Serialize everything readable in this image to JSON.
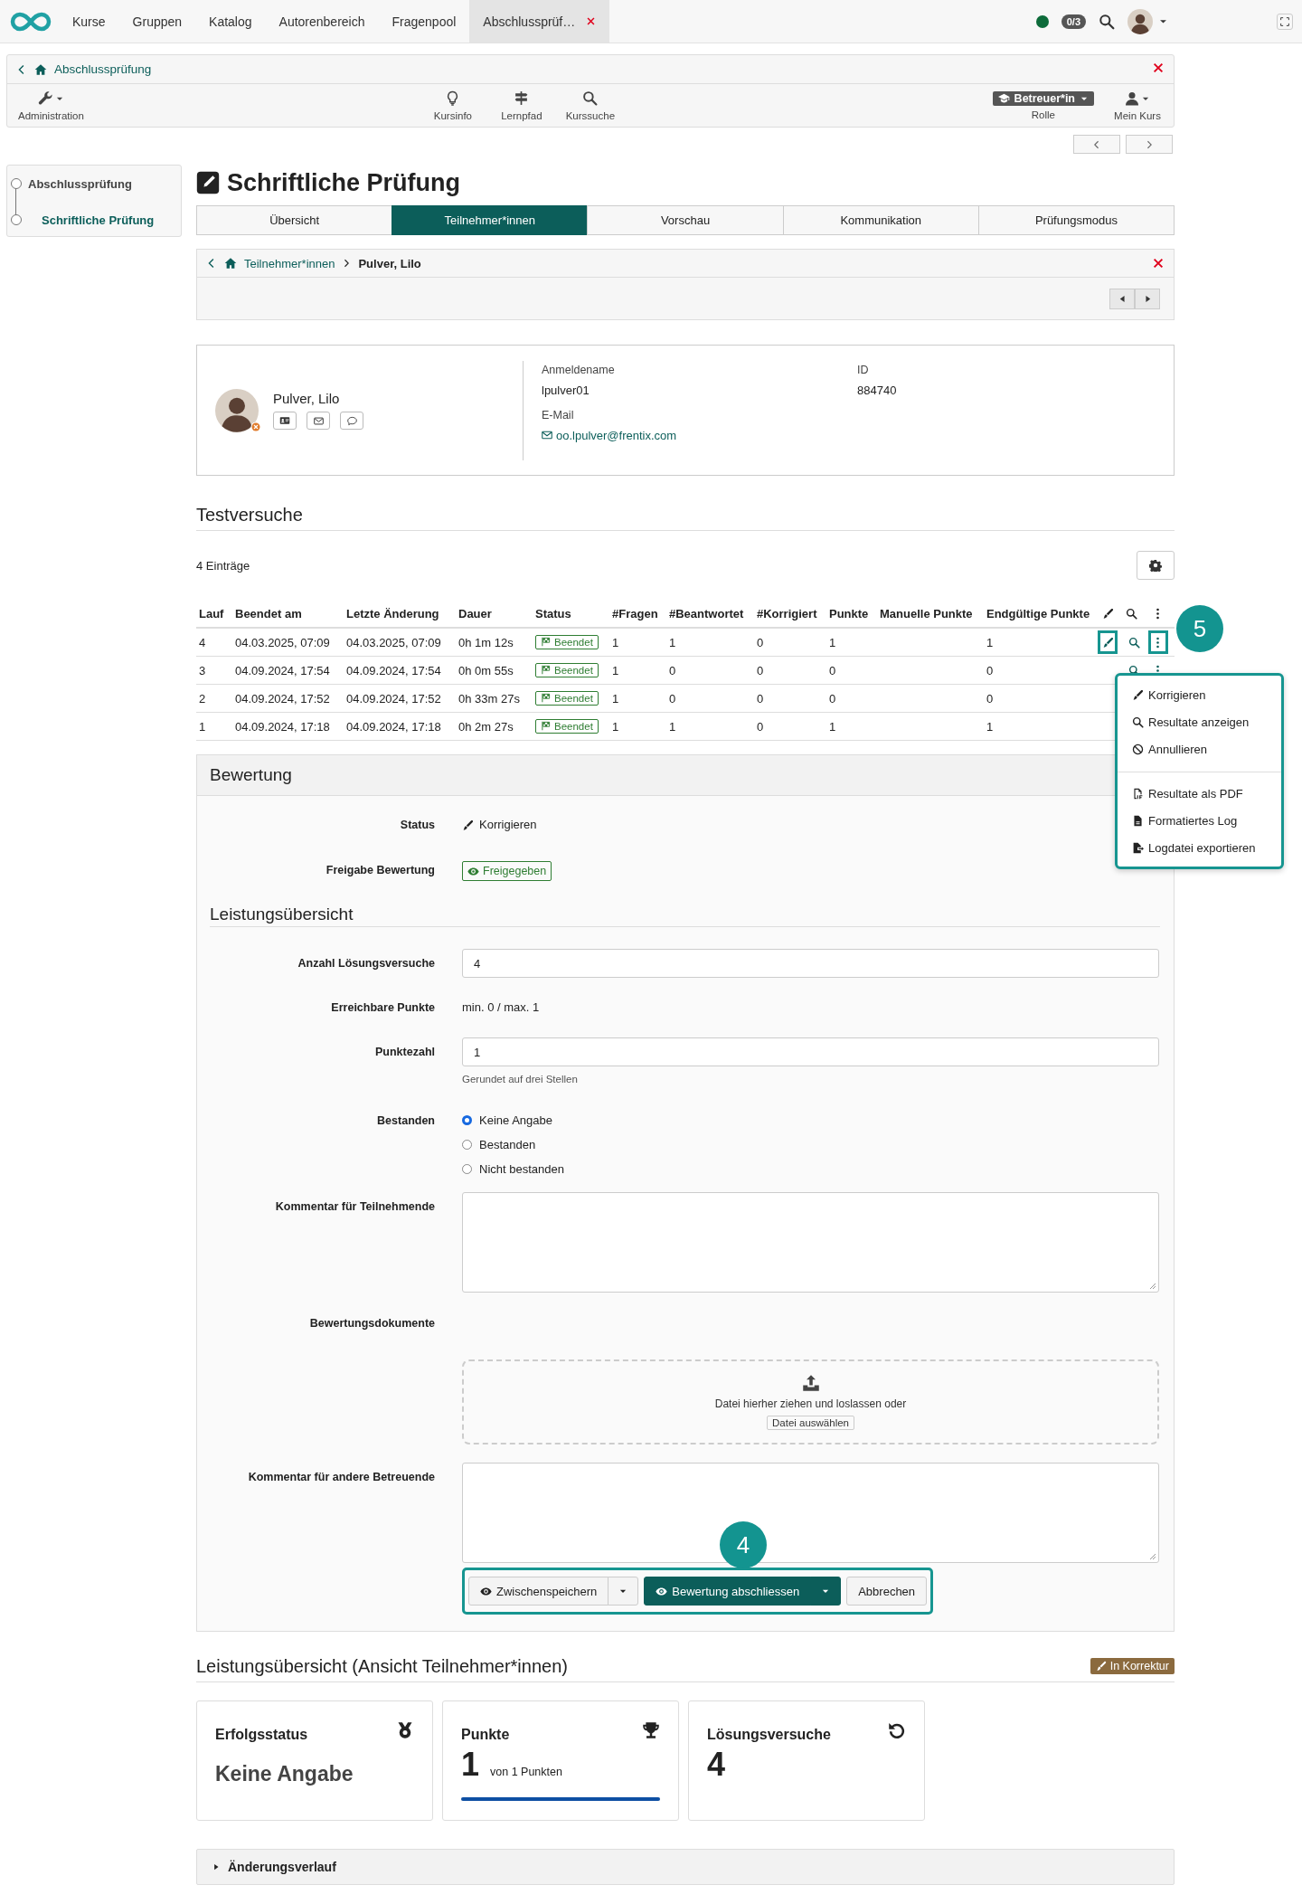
{
  "top_nav": {
    "tabs": [
      {
        "label": "Kurse",
        "selected": false,
        "closable": false
      },
      {
        "label": "Gruppen",
        "selected": false,
        "closable": false
      },
      {
        "label": "Katalog",
        "selected": false,
        "closable": false
      },
      {
        "label": "Autorenbereich",
        "selected": false,
        "closable": false
      },
      {
        "label": "Fragenpool",
        "selected": false,
        "closable": false
      },
      {
        "label": "Abschlussprüf…",
        "selected": true,
        "closable": true
      }
    ],
    "online": true,
    "counter": "0/3"
  },
  "course_bar": {
    "title": "Abschlussprüfung",
    "tools": [
      {
        "kind": "admin",
        "label": "Administration"
      },
      {
        "kind": "info",
        "label": "Kursinfo"
      },
      {
        "kind": "path",
        "label": "Lernpfad"
      },
      {
        "kind": "search",
        "label": "Kurssuche"
      }
    ],
    "role": {
      "value": "Betreuer*in",
      "label": "Rolle"
    },
    "my_course": "Mein Kurs"
  },
  "sidebar": {
    "items": [
      {
        "label": "Abschlussprüfung",
        "selected": false,
        "children": [
          {
            "label": "Schriftliche Prüfung",
            "selected": true
          }
        ]
      }
    ]
  },
  "page_title": "Schriftliche Prüfung",
  "tabs": [
    {
      "label": "Übersicht",
      "selected": false
    },
    {
      "label": "Teilnehmer*innen",
      "selected": true
    },
    {
      "label": "Vorschau",
      "selected": false
    },
    {
      "label": "Kommunikation",
      "selected": false
    },
    {
      "label": "Prüfungsmodus",
      "selected": false
    }
  ],
  "breadcrumb": [
    {
      "label": "Teilnehmer*innen",
      "kind": "link"
    },
    {
      "label": "Pulver, Lilo",
      "kind": "current"
    }
  ],
  "profile": {
    "name": "Pulver, Lilo",
    "fields": [
      {
        "label": "Anmeldename",
        "value": "lpulver01",
        "kind": "text"
      },
      {
        "label": "ID",
        "value": "884740",
        "kind": "text"
      },
      {
        "label": "E-Mail",
        "value": "oo.lpulver@frentix.com",
        "kind": "email"
      }
    ]
  },
  "attempts": {
    "title": "Testversuche",
    "count": "4 Einträge",
    "marker": "5",
    "columns": [
      {
        "label": "Lauf",
        "kind": "text"
      },
      {
        "label": "Beendet am",
        "kind": "text"
      },
      {
        "label": "Letzte Änderung",
        "kind": "text"
      },
      {
        "label": "Dauer",
        "kind": "text"
      },
      {
        "label": "Status",
        "kind": "status"
      },
      {
        "label": "#Fragen",
        "kind": "text"
      },
      {
        "label": "#Beantwortet",
        "kind": "text"
      },
      {
        "label": "#Korrigiert",
        "kind": "text"
      },
      {
        "label": "Punkte",
        "kind": "text"
      },
      {
        "label": "Manuelle Punkte",
        "kind": "text"
      },
      {
        "label": "Endgültige Punkte",
        "kind": "text"
      },
      {
        "kind": "edit"
      },
      {
        "kind": "search"
      },
      {
        "kind": "more"
      }
    ],
    "rows": [
      {
        "cells": [
          "4",
          "04.03.2025, 07:09",
          "04.03.2025, 07:09",
          "0h 1m 12s",
          "Beendet",
          "1",
          "1",
          "0",
          "1",
          "",
          "1"
        ],
        "actions": [
          {
            "kind": "edit",
            "highlighted": true
          },
          {
            "kind": "search",
            "highlighted": false
          },
          {
            "kind": "more",
            "highlighted": true
          }
        ]
      },
      {
        "cells": [
          "3",
          "04.09.2024, 17:54",
          "04.09.2024, 17:54",
          "0h 0m 55s",
          "Beendet",
          "1",
          "0",
          "0",
          "0",
          "",
          "0"
        ],
        "actions": [
          {
            "kind": "search",
            "highlighted": false
          },
          {
            "kind": "more",
            "highlighted": false
          }
        ]
      },
      {
        "cells": [
          "2",
          "04.09.2024, 17:52",
          "04.09.2024, 17:52",
          "0h 33m 27s",
          "Beendet",
          "1",
          "0",
          "0",
          "0",
          "",
          "0"
        ]
      },
      {
        "cells": [
          "1",
          "04.09.2024, 17:18",
          "04.09.2024, 17:18",
          "0h 2m 27s",
          "Beendet",
          "1",
          "1",
          "0",
          "1",
          "",
          "1"
        ]
      }
    ],
    "menu": {
      "highlighted": true,
      "groups": [
        [
          {
            "kind": "edit",
            "label": "Korrigieren"
          },
          {
            "kind": "search",
            "label": "Resultate anzeigen"
          },
          {
            "kind": "cancel",
            "label": "Annullieren"
          }
        ],
        [
          {
            "kind": "pdf",
            "label": "Resultate als PDF"
          },
          {
            "kind": "log",
            "label": "Formatiertes Log"
          },
          {
            "kind": "export",
            "label": "Logdatei exportieren"
          }
        ]
      ]
    }
  },
  "assessment": {
    "title": "Bewertung",
    "fields": [
      {
        "kind": "status",
        "label": "Status",
        "value": "Korrigieren"
      },
      {
        "kind": "badge",
        "label": "Freigabe Bewertung",
        "value": "Freigegeben"
      },
      {
        "kind": "heading",
        "label": "Leistungsübersicht"
      },
      {
        "kind": "input",
        "label": "Anzahl Lösungsversuche",
        "value": "4"
      },
      {
        "kind": "text",
        "label": "Erreichbare Punkte",
        "value": "min. 0 / max. 1"
      },
      {
        "kind": "input",
        "label": "Punktezahl",
        "value": "1",
        "hint": "Gerundet auf drei Stellen"
      },
      {
        "kind": "radio",
        "label": "Bestanden",
        "options": [
          {
            "label": "Keine Angabe",
            "selected": true
          },
          {
            "label": "Bestanden",
            "selected": false
          },
          {
            "label": "Nicht bestanden",
            "selected": false
          }
        ]
      },
      {
        "kind": "textarea",
        "label": "Kommentar für Teilnehmende"
      },
      {
        "kind": "upload",
        "label": "Bewertungsdokumente",
        "text": "Datei hierher ziehen und loslassen oder",
        "button": "Datei auswählen"
      },
      {
        "kind": "textarea",
        "label": "Kommentar für andere Betreuende"
      }
    ],
    "buttons": {
      "highlighted": true,
      "marker": "4",
      "items": [
        {
          "kind": "split",
          "label": "Zwischenspeichern",
          "primary": false
        },
        {
          "kind": "split",
          "label": "Bewertung abschliessen",
          "primary": true
        },
        {
          "kind": "plain",
          "label": "Abbrechen"
        }
      ]
    }
  },
  "participant_view": {
    "title": "Leistungsübersicht (Ansicht Teilnehmer*innen)",
    "badge": "In Korrektur",
    "cards": [
      {
        "kind": "status",
        "title": "Erfolgsstatus",
        "value": "Keine Angabe"
      },
      {
        "kind": "points",
        "title": "Punkte",
        "value": "1",
        "suffix": "von 1 Punkten",
        "level": 1
      },
      {
        "kind": "attempts",
        "title": "Lösungsversuche",
        "value": "4"
      }
    ]
  },
  "history": {
    "label": "Änderungsverlauf",
    "expanded": false
  }
}
